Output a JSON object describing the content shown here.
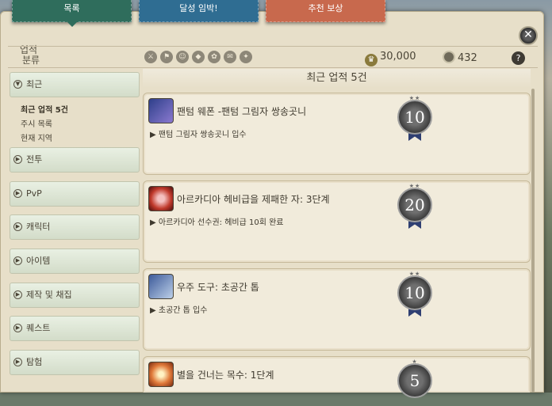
{
  "tabs": [
    {
      "label": "목록"
    },
    {
      "label": "달성 임박!"
    },
    {
      "label": "추천 보상"
    }
  ],
  "window": {
    "title": "업적"
  },
  "filter": {
    "label": "분류"
  },
  "scores": {
    "points": "30,000",
    "coins": "432"
  },
  "sidebar": {
    "categories": [
      {
        "label": "최근"
      },
      {
        "label": "전투"
      },
      {
        "label": "PvP"
      },
      {
        "label": "캐릭터"
      },
      {
        "label": "아이템"
      },
      {
        "label": "제작 및 채집"
      },
      {
        "label": "퀘스트"
      },
      {
        "label": "탐험"
      }
    ],
    "recent_subitems": [
      {
        "label": "최근 업적 5건"
      },
      {
        "label": "주시 목록"
      },
      {
        "label": "현재 지역"
      }
    ]
  },
  "main": {
    "header": "최근 업적 5건"
  },
  "achievements": [
    {
      "name": "팬텀 웨폰 -팬텀 그림자 쌍송곳니",
      "desc": "▶ 팬텀 그림자 쌍송곳니 입수",
      "points": "10",
      "stars": "★★"
    },
    {
      "name": "아르카디아 헤비급을 제패한 자: 3단계",
      "desc": "▶ 아르카디아 선수권: 헤비급 10회 완료",
      "points": "20",
      "stars": "★★"
    },
    {
      "name": "우주 도구: 초공간 톱",
      "desc": "▶ 초공간 톱 입수",
      "points": "10",
      "stars": "★★"
    },
    {
      "name": "별을 건너는 목수: 1단계",
      "desc": "",
      "points": "5",
      "stars": "★"
    }
  ],
  "colors": {
    "tab_list": "#2f6d5c",
    "tab_near": "#2f6d92",
    "tab_reward": "#c8694d",
    "badge_ribbon": "#2f3f72"
  }
}
